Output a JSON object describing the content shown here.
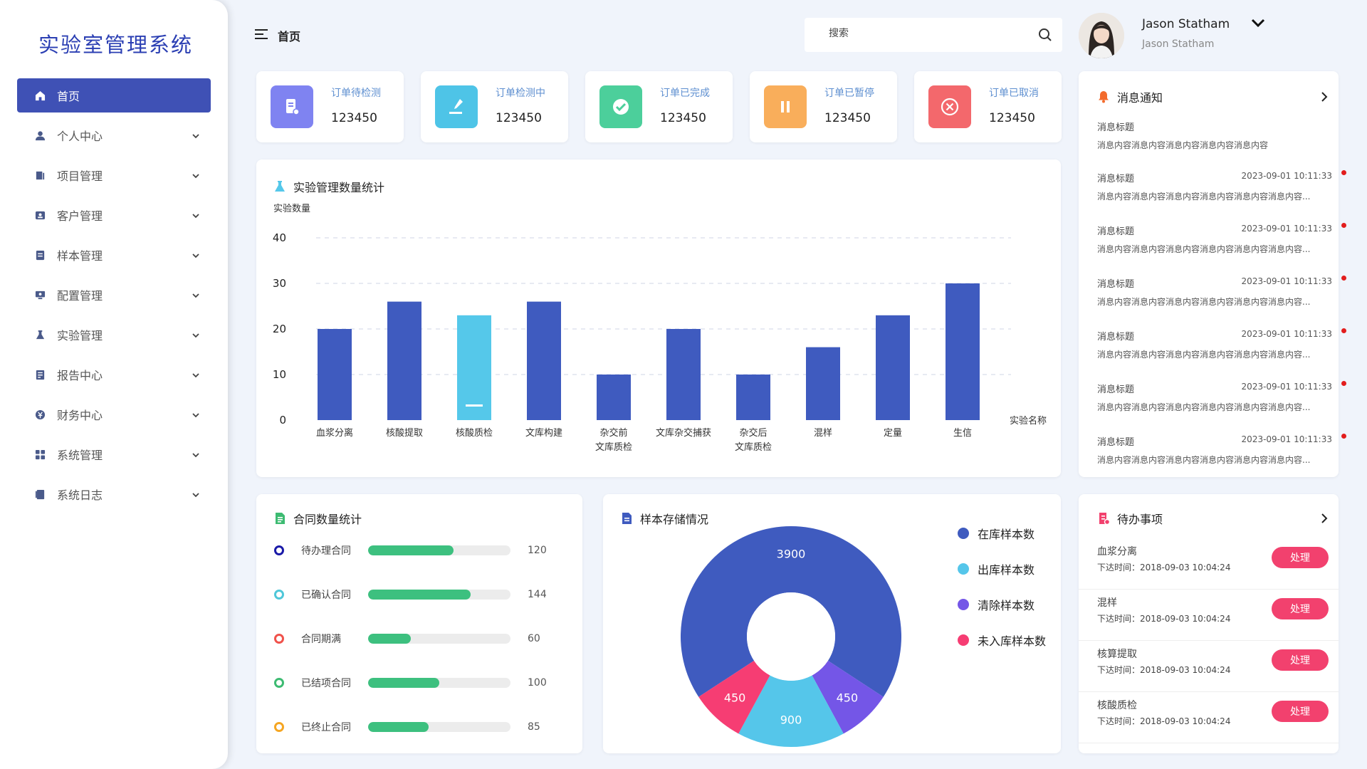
{
  "sidebar": {
    "brand": "实验室管理系统",
    "items": [
      {
        "label": "首页",
        "icon": "home-icon",
        "active": true
      },
      {
        "label": "个人中心",
        "icon": "user-icon"
      },
      {
        "label": "项目管理",
        "icon": "project-icon"
      },
      {
        "label": "客户管理",
        "icon": "customer-icon"
      },
      {
        "label": "样本管理",
        "icon": "sample-icon"
      },
      {
        "label": "配置管理",
        "icon": "config-icon"
      },
      {
        "label": "实验管理",
        "icon": "flask-icon"
      },
      {
        "label": "报告中心",
        "icon": "report-icon"
      },
      {
        "label": "财务中心",
        "icon": "finance-icon"
      },
      {
        "label": "系统管理",
        "icon": "grid-icon"
      },
      {
        "label": "系统日志",
        "icon": "log-icon"
      }
    ]
  },
  "topbar": {
    "title": "首页",
    "search_placeholder": "搜索",
    "user_name": "Jason Statham",
    "user_sub": "Jason Statham"
  },
  "stats": [
    {
      "label": "订单待检测",
      "value": "123450",
      "color": "#7f83f1",
      "icon": "document-icon"
    },
    {
      "label": "订单检测中",
      "value": "123450",
      "color": "#4ec4e7",
      "icon": "pipette-icon"
    },
    {
      "label": "订单已完成",
      "value": "123450",
      "color": "#4ccf9b",
      "icon": "check-icon"
    },
    {
      "label": "订单已暂停",
      "value": "123450",
      "color": "#f9ae5b",
      "icon": "pause-icon"
    },
    {
      "label": "订单已取消",
      "value": "123450",
      "color": "#f3686c",
      "icon": "cancel-icon"
    }
  ],
  "chart_data": [
    {
      "type": "bar",
      "title": "实验管理数量统计",
      "ylabel": "实验数量",
      "xlabel": "实验名称",
      "categories": [
        "血浆分离",
        "核酸提取",
        "核酸质检",
        "文库构建",
        "杂交前\n文库质检",
        "文库杂交捕获",
        "杂交后\n文库质检",
        "混样",
        "定量",
        "生信"
      ],
      "values": [
        20,
        26,
        23,
        26,
        10,
        20,
        10,
        16,
        23,
        30
      ],
      "highlight_index": 2,
      "ylim": [
        0,
        40
      ],
      "yticks": [
        0,
        10,
        20,
        30,
        40
      ],
      "colors": {
        "bar": "#3f5bbf",
        "highlight": "#55c8ea"
      }
    },
    {
      "type": "pie",
      "title": "样本存储情况",
      "slices": [
        {
          "name": "在库样本数",
          "value": 3900,
          "color": "#3f5bbf"
        },
        {
          "name": "清除样本数",
          "value": 450,
          "color": "#7456e7"
        },
        {
          "name": "出库样本数",
          "value": 900,
          "color": "#55c6ea"
        },
        {
          "name": "未入库样本数",
          "value": 450,
          "color": "#f63d73"
        }
      ]
    }
  ],
  "messages": {
    "title": "消息通知",
    "items": [
      {
        "title": "消息标题",
        "time": "",
        "body": "消息内容消息内容消息内容消息内容消息内容",
        "dot": false
      },
      {
        "title": "消息标题",
        "time": "2023-09-01 10:11:33",
        "body": "消息内容消息内容消息内容消息内容消息内容消息内容...",
        "dot": true
      },
      {
        "title": "消息标题",
        "time": "2023-09-01 10:11:33",
        "body": "消息内容消息内容消息内容消息内容消息内容消息内容...",
        "dot": true
      },
      {
        "title": "消息标题",
        "time": "2023-09-01 10:11:33",
        "body": "消息内容消息内容消息内容消息内容消息内容消息内容...",
        "dot": true
      },
      {
        "title": "消息标题",
        "time": "2023-09-01 10:11:33",
        "body": "消息内容消息内容消息内容消息内容消息内容消息内容...",
        "dot": true
      },
      {
        "title": "消息标题",
        "time": "2023-09-01 10:11:33",
        "body": "消息内容消息内容消息内容消息内容消息内容消息内容...",
        "dot": true
      },
      {
        "title": "消息标题",
        "time": "2023-09-01 10:11:33",
        "body": "消息内容消息内容消息内容消息内容消息内容消息内容...",
        "dot": true
      }
    ]
  },
  "contracts": {
    "title": "合同数量统计",
    "max": 200,
    "items": [
      {
        "label": "待办理合同",
        "value": 120,
        "color": "#1a1aa8"
      },
      {
        "label": "已确认合同",
        "value": 144,
        "color": "#4fc7d9"
      },
      {
        "label": "合同期满",
        "value": 60,
        "color": "#f0524b"
      },
      {
        "label": "已结项合同",
        "value": 100,
        "color": "#3dbb72"
      },
      {
        "label": "已终止合同",
        "value": 85,
        "color": "#f5a623"
      }
    ]
  },
  "storage": {
    "legend": [
      {
        "name": "在库样本数",
        "color": "#3f5bbf"
      },
      {
        "name": "出库样本数",
        "color": "#55c6ea"
      },
      {
        "name": "清除样本数",
        "color": "#7456e7"
      },
      {
        "name": "未入库样本数",
        "color": "#f63d73"
      }
    ]
  },
  "todos": {
    "title": "待办事项",
    "time_prefix": "下达时间：",
    "button_label": "处理",
    "items": [
      {
        "title": "血浆分离",
        "time": "下达时间：2018-09-03 10:04:24"
      },
      {
        "title": "混样",
        "time": "下达时间：2018-09-03 10:04:24"
      },
      {
        "title": "核算提取",
        "time": "下达时间：2018-09-03 10:04:24"
      },
      {
        "title": "核酸质检",
        "time": "下达时间：2018-09-03 10:04:24"
      }
    ]
  }
}
